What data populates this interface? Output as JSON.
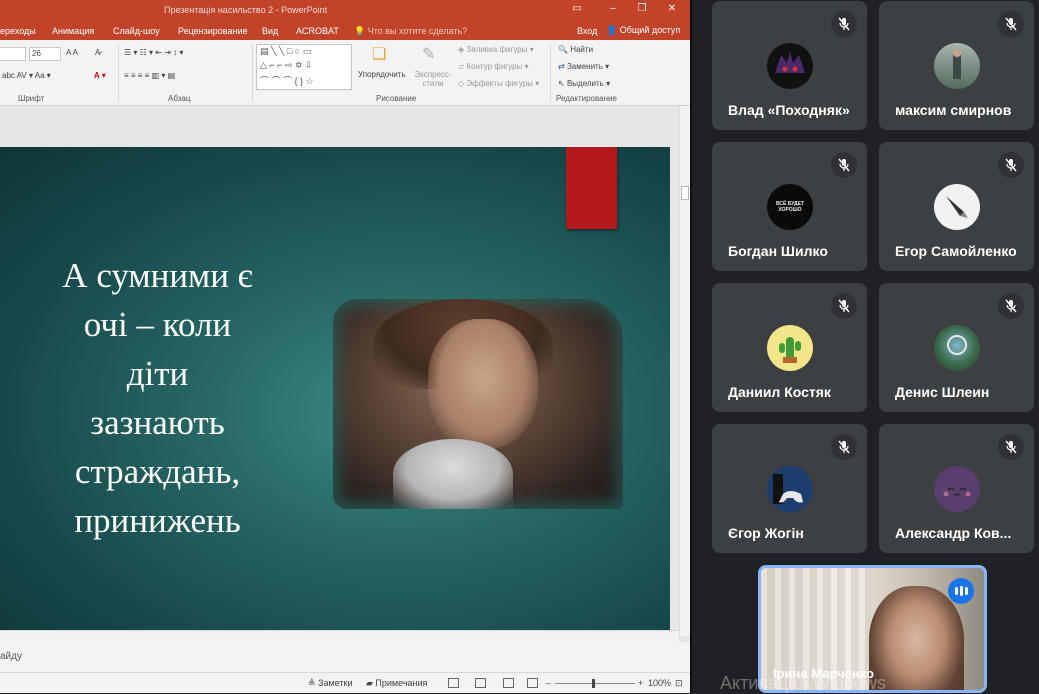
{
  "ppt": {
    "window_title": "Презентація насильство 2 - PowerPoint",
    "tabs": [
      "ереходы",
      "Анимация",
      "Слайд-шоу",
      "Рецензирование",
      "Вид",
      "ACROBAT"
    ],
    "tell_me": "Что вы хотите сделать?",
    "login": "Вход",
    "share": "Общий доступ",
    "ribbon": {
      "font_size": "26",
      "group_font": "Шрифт",
      "group_paragraph": "Абзац",
      "group_drawing": "Рисование",
      "group_editing": "Редактирование",
      "arrange": "Упорядочить",
      "quick_styles": "Экспресс-стили",
      "shape_fill": "Заливка фигуры",
      "shape_outline": "Контур фигуры",
      "shape_effects": "Эффекты фигуры",
      "find": "Найти",
      "replace": "Заменить",
      "select": "Выделить"
    },
    "slide": {
      "text_lines": [
        "А сумними є",
        "очі – коли",
        "діти",
        "зазнають",
        "страждань,",
        "принижень"
      ]
    },
    "status": {
      "slide_label": "айду",
      "notes": "Заметки",
      "comments": "Примечания",
      "zoom": "100%"
    }
  },
  "meet": {
    "participants": [
      {
        "name": "Влад «Походняк»",
        "avatar": "purple-monster-avatar",
        "muted": true
      },
      {
        "name": "максим смирнов",
        "avatar": "photo-avatar",
        "muted": true
      },
      {
        "name": "Богдан Шилко",
        "avatar": "text-logo-avatar",
        "avatar_text": "ВСЁ БУДЕТ ХОРОШО",
        "muted": true
      },
      {
        "name": "Егор Самойленко",
        "avatar": "pen-sketch-avatar",
        "muted": true
      },
      {
        "name": "Даниил Костяк",
        "avatar": "cactus-avatar",
        "muted": true
      },
      {
        "name": "Денис Шлеин",
        "avatar": "nature-avatar",
        "muted": true
      },
      {
        "name": "Єгор Жогін",
        "avatar": "gamepad-avatar",
        "muted": true
      },
      {
        "name": "Александр Ков...",
        "avatar": "cute-face-avatar",
        "muted": true
      }
    ],
    "self": {
      "name": "Ірина Марченко",
      "speaking": true
    },
    "watermark": "Активация Windows"
  }
}
